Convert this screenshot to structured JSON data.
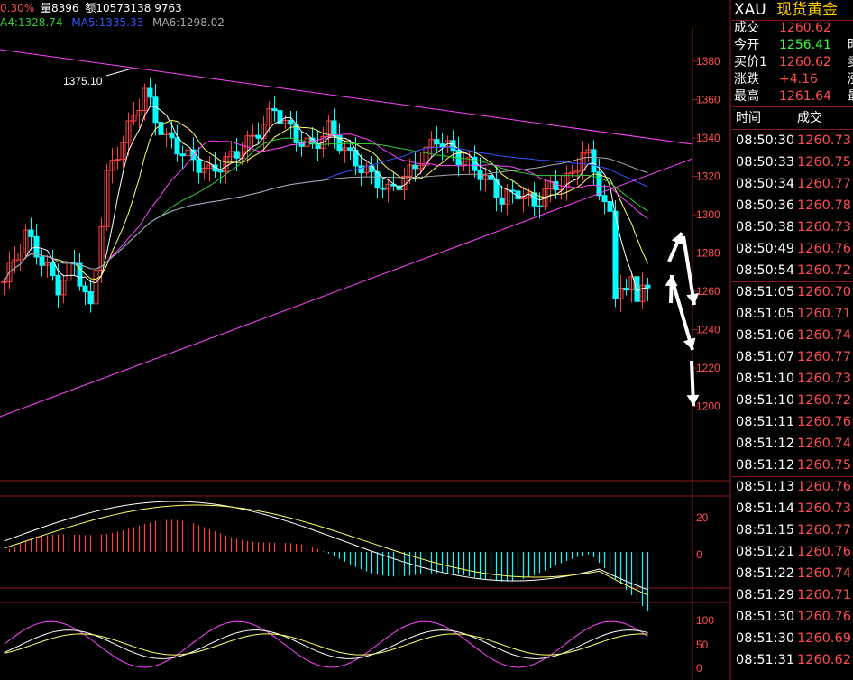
{
  "top_info": {
    "change_pct": "0.30%",
    "volume": "量8396",
    "amount": "额10573138 9763"
  },
  "ma_legend": [
    {
      "label": "A4:1328.74",
      "color": "#33cc33"
    },
    {
      "label": "MA5:1335.33",
      "color": "#3355ff"
    },
    {
      "label": "MA6:1298.02",
      "color": "#aaaaaa"
    }
  ],
  "price_axis": [
    "1380",
    "1360",
    "1340",
    "1320",
    "1300",
    "1280",
    "1260",
    "1240",
    "1220",
    "1200"
  ],
  "macd_axis": [
    "20",
    "0"
  ],
  "kdj_axis": [
    "100",
    "50",
    "0"
  ],
  "high_annotation": "1375.10",
  "colors": {
    "up": "#ff4040",
    "down": "#00ffff",
    "frame": "#8b1a1a",
    "trend": "#ff44ff"
  },
  "right_panel": {
    "symbol": "XAU",
    "name": "现货黄金",
    "quotes": [
      {
        "label": "成交",
        "value": "1260.62",
        "color": "#ff4d4d",
        "extra": ""
      },
      {
        "label": "今开",
        "value": "1256.41",
        "color": "#33ff33",
        "extra": "时"
      },
      {
        "label": "买价1",
        "value": "1260.62",
        "color": "#ff4d4d",
        "extra": "卖"
      },
      {
        "label": "涨跌",
        "value": "+4.16",
        "color": "#ff4d4d",
        "extra": "涨"
      },
      {
        "label": "最高",
        "value": "1261.64",
        "color": "#ff4d4d",
        "extra": "最"
      }
    ],
    "tick_header": {
      "time": "时间",
      "price": "成交"
    },
    "ticks": [
      {
        "time": "08:50:30",
        "price": "1260.73"
      },
      {
        "time": "08:50:33",
        "price": "1260.75"
      },
      {
        "time": "08:50:34",
        "price": "1260.77"
      },
      {
        "time": "08:50:36",
        "price": "1260.78"
      },
      {
        "time": "08:50:38",
        "price": "1260.73"
      },
      {
        "time": "08:50:49",
        "price": "1260.76"
      },
      {
        "time": "08:50:54",
        "price": "1260.72"
      },
      {
        "time": "08:51:05",
        "price": "1260.70"
      },
      {
        "time": "08:51:05",
        "price": "1260.71"
      },
      {
        "time": "08:51:06",
        "price": "1260.74"
      },
      {
        "time": "08:51:07",
        "price": "1260.77"
      },
      {
        "time": "08:51:10",
        "price": "1260.73"
      },
      {
        "time": "08:51:10",
        "price": "1260.72"
      },
      {
        "time": "08:51:11",
        "price": "1260.76"
      },
      {
        "time": "08:51:12",
        "price": "1260.74"
      },
      {
        "time": "08:51:12",
        "price": "1260.75"
      },
      {
        "time": "08:51:13",
        "price": "1260.76"
      },
      {
        "time": "08:51:14",
        "price": "1260.73"
      },
      {
        "time": "08:51:15",
        "price": "1260.77"
      },
      {
        "time": "08:51:21",
        "price": "1260.76"
      },
      {
        "time": "08:51:22",
        "price": "1260.74"
      },
      {
        "time": "08:51:29",
        "price": "1260.71"
      },
      {
        "time": "08:51:30",
        "price": "1260.76"
      },
      {
        "time": "08:51:30",
        "price": "1260.69"
      },
      {
        "time": "08:51:31",
        "price": "1260.62"
      }
    ]
  }
}
